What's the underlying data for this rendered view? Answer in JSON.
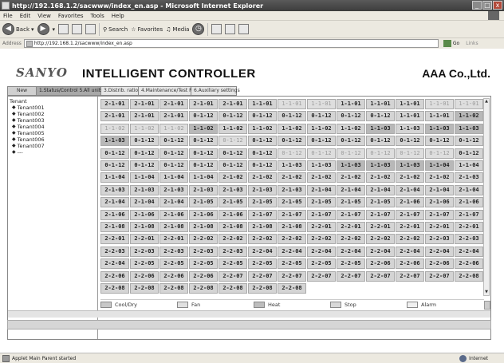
{
  "window": {
    "title": "http://192.168.1.2/sacwww/index_en.asp - Microsoft Internet Explorer",
    "min": "_",
    "max": "□",
    "close": "x"
  },
  "menu": [
    "File",
    "Edit",
    "View",
    "Favorites",
    "Tools",
    "Help"
  ],
  "toolbar": {
    "back": "Back",
    "search": "Search",
    "favorites": "Favorites",
    "media": "Media"
  },
  "address": {
    "label": "Address",
    "url": "http://192.168.1.2/sacwww/index_en.asp",
    "go": "Go",
    "links": "Links"
  },
  "app": {
    "logo": "SANYO",
    "title": "INTELLIGENT CONTROLLER",
    "company": "AAA Co.,Ltd."
  },
  "tabs": [
    {
      "label": "New",
      "active": false
    },
    {
      "label": "1.Status/Control 5.All units",
      "active": true
    },
    {
      "label": "3.Distrib. ratio",
      "active": false
    },
    {
      "label": "4.Maintenance/Test Run",
      "active": false
    },
    {
      "label": "6.Auxiliary settings",
      "active": false
    }
  ],
  "tree": {
    "root": "Tenant",
    "nodes": [
      "Tenant001",
      "Tenant002",
      "Tenant003",
      "Tenant004",
      "Tenant005",
      "Tenant006",
      "Tenant007",
      "---"
    ]
  },
  "grid": [
    [
      "2-1-01",
      "2-1-01",
      "2-1-01",
      "2-1-01",
      "2-1-01",
      "1-1-01",
      "1-1-01",
      "1-1-01",
      "1-1-01",
      "1-1-01",
      "1-1-01",
      "1-1-01",
      "1-1-01"
    ],
    [
      "2-1-01",
      "2-1-01",
      "2-1-01",
      "0-1-12",
      "0-1-12",
      "0-1-12",
      "0-1-12",
      "0-1-12",
      "0-1-12",
      "0-1-12",
      "1-1-01",
      "1-1-01",
      "1-1-02"
    ],
    [
      "1-1-02",
      "1-1-02",
      "1-1-02",
      "1-1-02",
      "1-1-02",
      "1-1-02",
      "1-1-02",
      "1-1-02",
      "1-1-02",
      "1-1-03",
      "1-1-03",
      "1-1-03",
      "1-1-03"
    ],
    [
      "1-1-03",
      "0-1-12",
      "0-1-12",
      "0-1-12",
      "0-1-12",
      "0-1-12",
      "0-1-12",
      "0-1-12",
      "0-1-12",
      "0-1-12",
      "0-1-12",
      "0-1-12",
      "0-1-12"
    ],
    [
      "0-1-12",
      "0-1-12",
      "0-1-12",
      "0-1-12",
      "0-1-12",
      "0-1-12",
      "0-1-12",
      "0-1-12",
      "0-1-12",
      "0-1-12",
      "0-1-12",
      "0-1-12",
      "0-1-12"
    ],
    [
      "0-1-12",
      "0-1-12",
      "0-1-12",
      "0-1-12",
      "0-1-12",
      "0-1-12",
      "1-1-03",
      "1-1-03",
      "1-1-03",
      "1-1-03",
      "1-1-03",
      "1-1-04",
      "1-1-04"
    ],
    [
      "1-1-04",
      "1-1-04",
      "1-1-04",
      "1-1-04",
      "2-1-02",
      "2-1-02",
      "2-1-02",
      "2-1-02",
      "2-1-02",
      "2-1-02",
      "2-1-02",
      "2-1-02",
      "2-1-03"
    ],
    [
      "2-1-03",
      "2-1-03",
      "2-1-03",
      "2-1-03",
      "2-1-03",
      "2-1-03",
      "2-1-03",
      "2-1-04",
      "2-1-04",
      "2-1-04",
      "2-1-04",
      "2-1-04",
      "2-1-04"
    ],
    [
      "2-1-04",
      "2-1-04",
      "2-1-04",
      "2-1-05",
      "2-1-05",
      "2-1-05",
      "2-1-05",
      "2-1-05",
      "2-1-05",
      "2-1-05",
      "2-1-06",
      "2-1-06",
      "2-1-06"
    ],
    [
      "2-1-06",
      "2-1-06",
      "2-1-06",
      "2-1-06",
      "2-1-06",
      "2-1-07",
      "2-1-07",
      "2-1-07",
      "2-1-07",
      "2-1-07",
      "2-1-07",
      "2-1-07",
      "2-1-07"
    ],
    [
      "2-1-08",
      "2-1-08",
      "2-1-08",
      "2-1-08",
      "2-1-08",
      "2-1-08",
      "2-1-08",
      "2-2-01",
      "2-2-01",
      "2-2-01",
      "2-2-01",
      "2-2-01",
      "2-2-01"
    ],
    [
      "2-2-01",
      "2-2-01",
      "2-2-01",
      "2-2-02",
      "2-2-02",
      "2-2-02",
      "2-2-02",
      "2-2-02",
      "2-2-02",
      "2-2-02",
      "2-2-02",
      "2-2-03",
      "2-2-03"
    ],
    [
      "2-2-03",
      "2-2-03",
      "2-2-03",
      "2-2-03",
      "2-2-03",
      "2-2-04",
      "2-2-04",
      "2-2-04",
      "2-2-04",
      "2-2-04",
      "2-2-04",
      "2-2-04",
      "2-2-04"
    ],
    [
      "2-2-04",
      "2-2-05",
      "2-2-05",
      "2-2-05",
      "2-2-05",
      "2-2-05",
      "2-2-05",
      "2-2-05",
      "2-2-05",
      "2-2-06",
      "2-2-06",
      "2-2-06",
      "2-2-06"
    ],
    [
      "2-2-06",
      "2-2-06",
      "2-2-06",
      "2-2-06",
      "2-2-07",
      "2-2-07",
      "2-2-07",
      "2-2-07",
      "2-2-07",
      "2-2-07",
      "2-2-07",
      "2-2-07",
      "2-2-08"
    ],
    [
      "2-2-08",
      "2-2-08",
      "2-2-08",
      "2-2-08",
      "2-2-08",
      "2-2-08",
      "2-2-08"
    ]
  ],
  "dim_cells": [
    [
      0,
      6
    ],
    [
      0,
      7
    ],
    [
      0,
      11
    ],
    [
      0,
      12
    ],
    [
      2,
      0
    ],
    [
      2,
      1
    ],
    [
      2,
      2
    ],
    [
      3,
      4
    ],
    [
      4,
      6
    ],
    [
      4,
      7
    ],
    [
      4,
      8
    ],
    [
      4,
      9
    ],
    [
      4,
      10
    ],
    [
      4,
      11
    ]
  ],
  "dark_cells": [
    [
      1,
      12
    ],
    [
      2,
      3
    ],
    [
      2,
      9
    ],
    [
      2,
      11
    ],
    [
      2,
      12
    ],
    [
      3,
      0
    ],
    [
      5,
      8
    ],
    [
      5,
      9
    ],
    [
      5,
      10
    ],
    [
      5,
      11
    ]
  ],
  "legend": [
    {
      "label": "Cool/Dry",
      "color": "#c8c8c8"
    },
    {
      "label": "Fan",
      "color": "#e0e0e0"
    },
    {
      "label": "Heat",
      "color": "#bdbdbd"
    },
    {
      "label": "Stop",
      "color": "#d8d8d8"
    },
    {
      "label": "Alarm",
      "color": "#f0f0f0"
    }
  ],
  "status": {
    "text": "Applet Main Parent started",
    "zone": "Internet"
  }
}
